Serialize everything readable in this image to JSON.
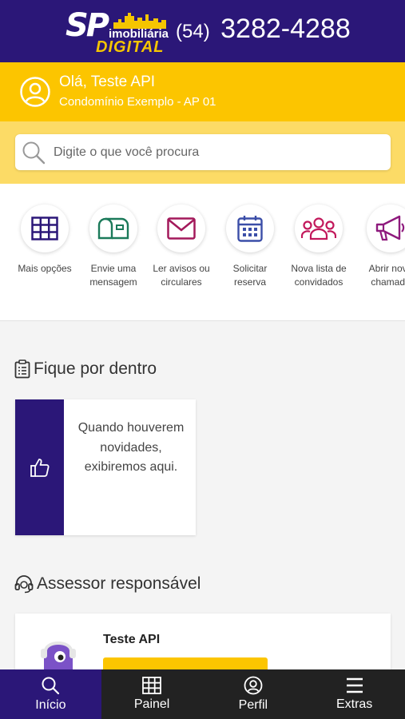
{
  "header": {
    "logo_sp": "SP",
    "logo_imobiliaria": "imobiliária",
    "logo_digital": "DIGITAL",
    "phone_ddd": "(54)",
    "phone_number": "3282-4288"
  },
  "user": {
    "greeting": "Olá, Teste API",
    "unit": "Condomínio Exemplo - AP 01"
  },
  "search": {
    "placeholder": "Digite o que você procura",
    "value": ""
  },
  "shortcuts": [
    {
      "label": "Mais opções",
      "icon": "grid-icon"
    },
    {
      "label": "Envie uma mensagem",
      "icon": "mailbox-icon"
    },
    {
      "label": "Ler avisos ou circulares",
      "icon": "envelope-icon"
    },
    {
      "label": "Solicitar reserva",
      "icon": "calendar-icon"
    },
    {
      "label": "Nova lista de convidados",
      "icon": "people-icon"
    },
    {
      "label": "Abrir novo chamado",
      "icon": "megaphone-icon"
    }
  ],
  "news": {
    "title": "Fique por dentro",
    "empty_message": "Quando houverem novidades, exibiremos aqui."
  },
  "advisor": {
    "title": "Assessor responsável",
    "name": "Teste API"
  },
  "tabs": [
    {
      "label": "Início",
      "icon": "search-icon",
      "active": true
    },
    {
      "label": "Painel",
      "icon": "grid-icon",
      "active": false
    },
    {
      "label": "Perfil",
      "icon": "user-icon",
      "active": false
    },
    {
      "label": "Extras",
      "icon": "menu-icon",
      "active": false
    }
  ],
  "colors": {
    "primary": "#2b1778",
    "accent": "#fcc500",
    "tabbar": "#222222"
  }
}
